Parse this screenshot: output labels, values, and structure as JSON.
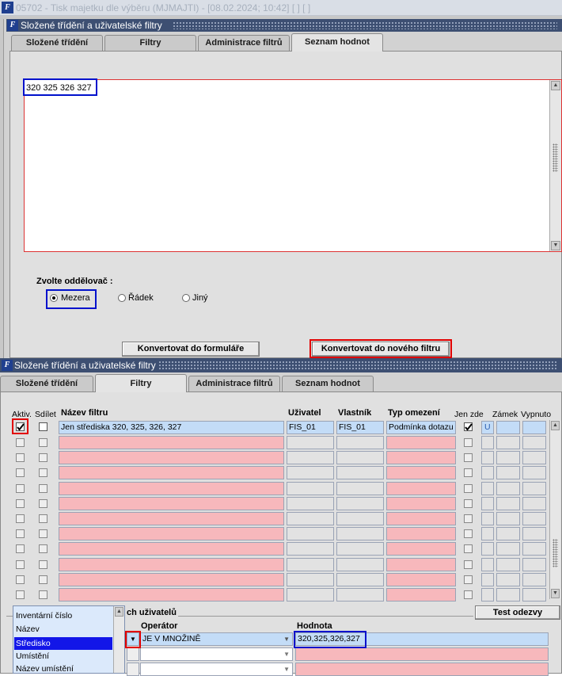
{
  "window": {
    "title": "05702 - Tisk majetku dle výběru (MJMAJTI) - [08.02.2024; 10:42]  [ ] [ ]",
    "logo": "F"
  },
  "panel1": {
    "title": "Složené třídění a uživatelské filtry",
    "tabs": [
      "Složené třídění",
      "Filtry",
      "Administrace filtrů",
      "Seznam hodnot"
    ],
    "active_tab": "Seznam hodnot",
    "textarea_value": "320 325 326 327",
    "separator_label": "Zvolte oddělovač :",
    "separators": [
      "Mezera",
      "Řádek",
      "Jiný"
    ],
    "separator_selected": "Mezera",
    "btn_convert_form": "Konvertovat do formuláře",
    "btn_convert_filter": "Konvertovat do nového filtru"
  },
  "panel2": {
    "title": "Složené třídění a uživatelské filtry",
    "tabs": [
      "Složené třídění",
      "Filtry",
      "Administrace filtrů",
      "Seznam hodnot"
    ],
    "active_tab": "Filtry",
    "columns": {
      "aktiv": "Aktiv.",
      "sdilet": "Sdílet",
      "nazev": "Název filtru",
      "uzivatel": "Uživatel",
      "vlastnik": "Vlastník",
      "typ": "Typ omezení",
      "jen_zde": "Jen zde",
      "zamek": "Zámek",
      "vypnuto": "Vypnuto"
    },
    "filter_row": {
      "aktiv": true,
      "sdilet": false,
      "nazev": "Jen střediska 320, 325, 326, 327",
      "uzivatel": "FIS_01",
      "vlastnik": "FIS_01",
      "typ": "Podmínka dotazu",
      "jen_zde": true,
      "zamek": "U",
      "vypnuto": ""
    },
    "empty_rows": 11,
    "section_label_partial": "ch uživatelů",
    "btn_test": "Test odezvy",
    "cond_columns": {
      "operator": "Operátor",
      "hodnota": "Hodnota"
    },
    "condition": {
      "operator": "JE V MNOŽINĚ",
      "hodnota": "320,325,326,327"
    },
    "dropdown_items": [
      "Inventární číslo",
      "Název",
      "Středisko",
      "Umístění",
      "Název umístění"
    ],
    "dropdown_selected": "Středisko"
  },
  "colors": {
    "title_bar": "#3d4f72",
    "pink_cell": "#f7b8bc",
    "blue_cell": "#c3dcf7",
    "highlight_red": "#e10000",
    "highlight_blue": "#0011cc"
  }
}
